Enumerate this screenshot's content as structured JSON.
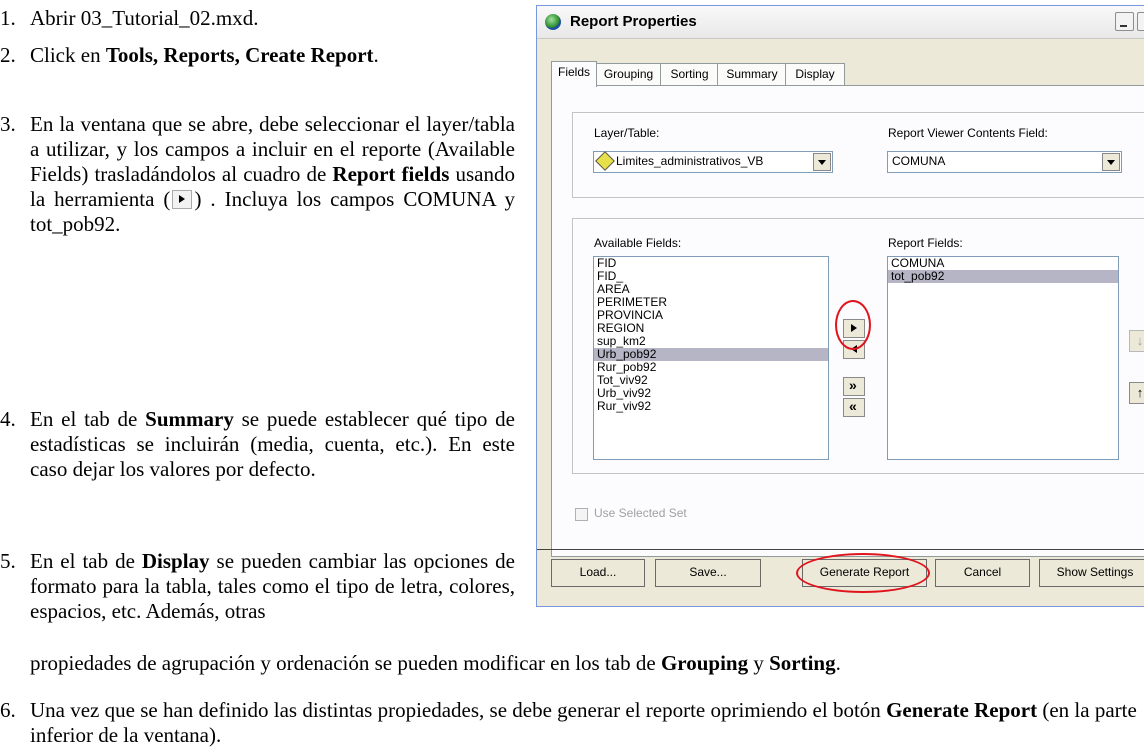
{
  "steps": [
    {
      "n": "1.",
      "parts": [
        {
          "t": "Abrir 03_Tutorial_02.mxd."
        }
      ]
    },
    {
      "n": "2.",
      "parts": [
        {
          "t": "Click en "
        },
        {
          "t": "Tools, Reports, Create Report",
          "b": true
        },
        {
          "t": "."
        }
      ]
    },
    {
      "n": "3.",
      "parts": [
        {
          "t": "En la ventana que se abre, debe seleccionar el layer/tabla a utilizar, y los campos a incluir en el reporte (Available Fields) trasladándolos al cuadro de "
        },
        {
          "t": "Report fields",
          "b": true
        },
        {
          "t": " usando la herramienta ("
        },
        {
          "icon": "arrow-right-button-icon"
        },
        {
          "t": ") . Incluya los campos COMUNA y tot_pob92."
        }
      ]
    },
    {
      "n": "4.",
      "parts": [
        {
          "t": "En el tab de "
        },
        {
          "t": "Summary",
          "b": true
        },
        {
          "t": " se puede establecer qué tipo de estadísticas se incluirán (media, cuenta, etc.). En este caso dejar los valores por defecto."
        }
      ]
    },
    {
      "n": "5.",
      "parts": [
        {
          "t": "En el tab de "
        },
        {
          "t": "Display",
          "b": true
        },
        {
          "t": " se pueden cambiar las opciones de formato para la tabla, tales como el tipo de letra, colores, espacios, etc. Además, otras"
        }
      ]
    },
    {
      "n": "",
      "parts": [
        {
          "t": "propiedades de agrupación y ordenación se pueden modificar en los tab de "
        },
        {
          "t": "Grouping",
          "b": true
        },
        {
          "t": " y "
        },
        {
          "t": "Sorting",
          "b": true
        },
        {
          "t": "."
        }
      ]
    },
    {
      "n": "6.",
      "parts": [
        {
          "t": "Una vez que se han definido las distintas propiedades, se debe generar el reporte oprimiendo el botón "
        },
        {
          "t": "Generate Report",
          "b": true
        },
        {
          "t": " (en la parte inferior de la ventana)."
        }
      ]
    }
  ],
  "dialog": {
    "title": "Report Properties",
    "tabs": [
      "Fields",
      "Grouping",
      "Sorting",
      "Summary",
      "Display"
    ],
    "layer_label": "Layer/Table:",
    "layer_value": "Limites_administrativos_VB",
    "contents_label": "Report Viewer Contents Field:",
    "contents_value": "COMUNA",
    "available_label": "Available Fields:",
    "available": [
      "FID",
      "FID_",
      "AREA",
      "PERIMETER",
      "PROVINCIA",
      "REGION",
      "sup_km2",
      "Urb_pob92",
      "Rur_pob92",
      "Tot_viv92",
      "Urb_viv92",
      "Rur_viv92"
    ],
    "available_selected": "Urb_pob92",
    "report_label": "Report Fields:",
    "report_fields": [
      "COMUNA",
      "tot_pob92"
    ],
    "report_selected": "tot_pob92",
    "use_selected": "Use Selected Set",
    "buttons": {
      "load": "Load...",
      "save": "Save...",
      "generate": "Generate Report",
      "cancel": "Cancel",
      "show": "Show Settings"
    },
    "highlight_color": "#e0141c"
  }
}
